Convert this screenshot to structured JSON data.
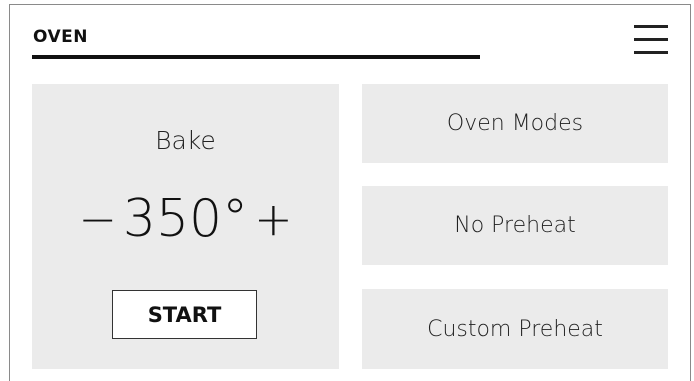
{
  "header": {
    "title": "OVEN"
  },
  "bake": {
    "mode_label": "Bake",
    "decrease_label": "−",
    "temperature": "350°",
    "increase_label": "+",
    "start_label": "START"
  },
  "options": {
    "oven_modes": "Oven Modes",
    "no_preheat": "No Preheat",
    "custom_preheat": "Custom Preheat"
  },
  "icons": {
    "menu": "hamburger-menu-icon"
  },
  "colors": {
    "panel_background": "#ebebeb",
    "text": "#111111",
    "background": "#ffffff"
  }
}
